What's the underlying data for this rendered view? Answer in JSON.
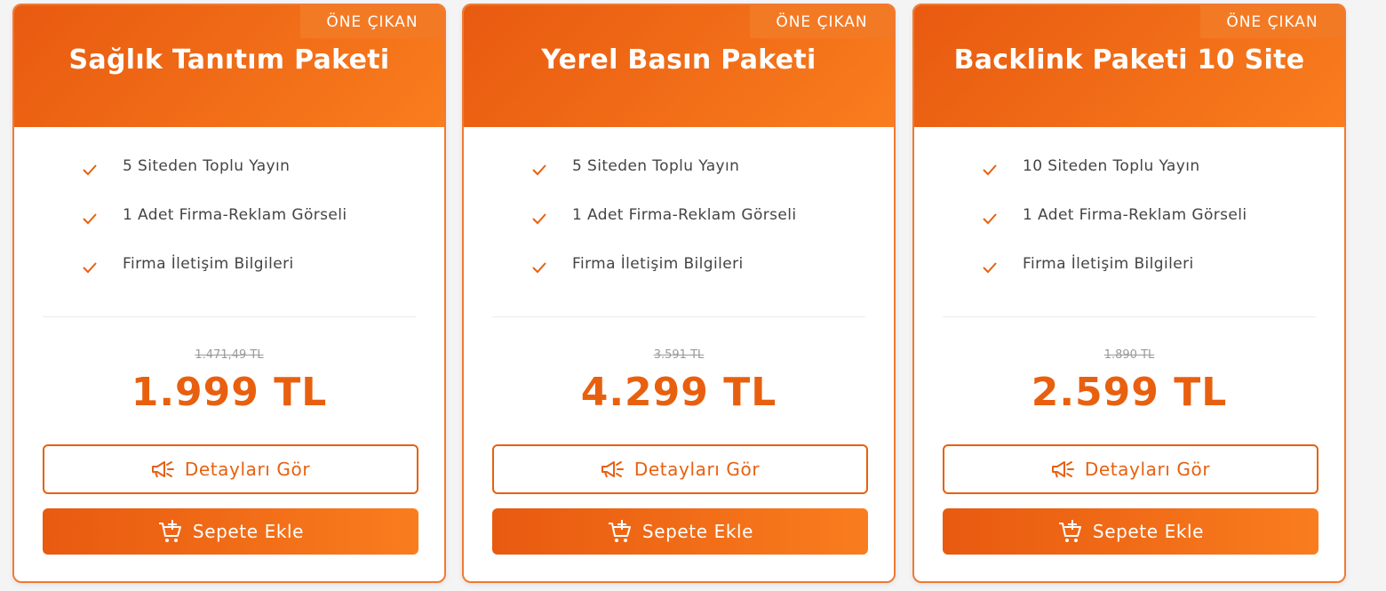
{
  "colors": {
    "accent": "#e8600f",
    "header_gradient_start": "#e85a10",
    "header_gradient_end": "#f97d1e"
  },
  "cards": [
    {
      "badge": "ÖNE ÇIKAN",
      "title": "Sağlık Tanıtım Paketi",
      "features": [
        "5 Siteden Toplu Yayın",
        "1 Adet Firma-Reklam Görseli",
        "Firma İletişim Bilgileri"
      ],
      "old_price": "1.471,49 TL",
      "price": "1.999 TL",
      "details_label": "Detayları Gör",
      "cart_label": "Sepete Ekle"
    },
    {
      "badge": "ÖNE ÇIKAN",
      "title": "Yerel Basın Paketi",
      "features": [
        "5 Siteden Toplu Yayın",
        "1 Adet Firma-Reklam Görseli",
        "Firma İletişim Bilgileri"
      ],
      "old_price": "3.591 TL",
      "price": "4.299 TL",
      "details_label": "Detayları Gör",
      "cart_label": "Sepete Ekle"
    },
    {
      "badge": "ÖNE ÇIKAN",
      "title": "Backlink Paketi 10 Site",
      "features": [
        "10 Siteden Toplu Yayın",
        "1 Adet Firma-Reklam Görseli",
        "Firma İletişim Bilgileri"
      ],
      "old_price": "1.890 TL",
      "price": "2.599 TL",
      "details_label": "Detayları Gör",
      "cart_label": "Sepete Ekle"
    }
  ],
  "icons": {
    "feature": "check-icon",
    "details": "megaphone-icon",
    "cart": "cart-add-icon"
  }
}
